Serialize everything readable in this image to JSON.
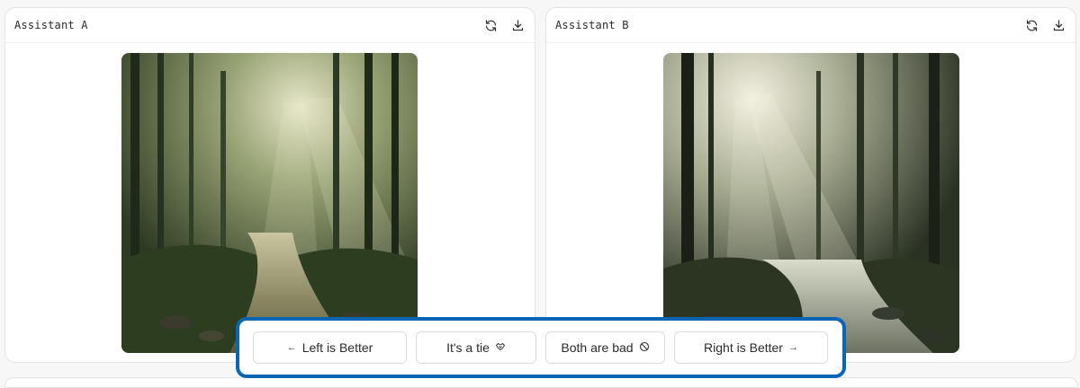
{
  "panels": [
    {
      "title": "Assistant A",
      "refresh_icon": "refresh-icon",
      "download_icon": "download-icon",
      "image": "misty forest river with sun rays"
    },
    {
      "title": "Assistant B",
      "refresh_icon": "refresh-icon",
      "download_icon": "download-icon",
      "image": "misty forest stream with sun rays"
    }
  ],
  "vote": {
    "left_label": "Left is Better",
    "left_icon": "←",
    "tie_label": "It's a tie",
    "tie_icon": "handshake-icon",
    "bad_label": "Both are bad",
    "bad_icon": "prohibited-icon",
    "right_label": "Right is Better",
    "right_icon": "→"
  },
  "colors": {
    "highlight_border": "#0a66b3",
    "panel_border": "#e3e3e6"
  }
}
